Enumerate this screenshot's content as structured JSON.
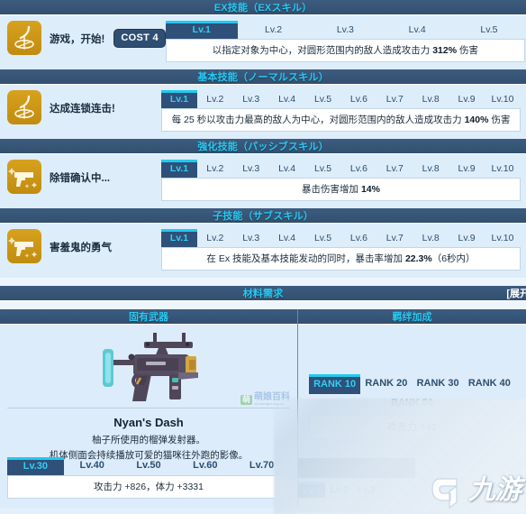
{
  "sections": {
    "ex": {
      "title": "EX技能（EXスキル）"
    },
    "normal": {
      "title": "基本技能（ノーマルスキル）"
    },
    "passive": {
      "title": "強化技能（パッシブスキル）"
    },
    "sub": {
      "title": "子技能（サブスキル）"
    },
    "material": {
      "title": "材料需求",
      "expand_label": "[展开"
    }
  },
  "skills": {
    "ex": {
      "icon_name": "ex-skill-icon",
      "name": "游戏，开始!",
      "cost": "COST 4",
      "levels": [
        "Lv.1",
        "Lv.2",
        "Lv.3",
        "Lv.4",
        "Lv.5"
      ],
      "active_level": 0,
      "desc_pre": "以指定对象为中心，对圆形范围内的敌人造成攻击力 ",
      "desc_value": "312%",
      "desc_post": " 伤害"
    },
    "normal": {
      "icon_name": "normal-skill-icon",
      "name": "达成连锁连击!",
      "levels": [
        "Lv.1",
        "Lv.2",
        "Lv.3",
        "Lv.4",
        "Lv.5",
        "Lv.6",
        "Lv.7",
        "Lv.8",
        "Lv.9",
        "Lv.10"
      ],
      "active_level": 0,
      "desc_pre": "每 25 秒以攻击力最高的敌人为中心，对圆形范围内的敌人造成攻击力 ",
      "desc_value": "140%",
      "desc_post": " 伤害"
    },
    "passive": {
      "icon_name": "passive-skill-icon",
      "name": "除错确认中...",
      "levels": [
        "Lv.1",
        "Lv.2",
        "Lv.3",
        "Lv.4",
        "Lv.5",
        "Lv.6",
        "Lv.7",
        "Lv.8",
        "Lv.9",
        "Lv.10"
      ],
      "active_level": 0,
      "desc_pre": "暴击伤害增加 ",
      "desc_value": "14%",
      "desc_post": ""
    },
    "sub": {
      "icon_name": "sub-skill-icon",
      "name": "害羞鬼的勇气",
      "levels": [
        "Lv.1",
        "Lv.2",
        "Lv.3",
        "Lv.4",
        "Lv.5",
        "Lv.6",
        "Lv.7",
        "Lv.8",
        "Lv.9",
        "Lv.10"
      ],
      "active_level": 0,
      "desc_pre": "在 Ex 技能及基本技能发动的同时，暴击率增加 ",
      "desc_value": "22.3%",
      "desc_post": "（6秒内）"
    }
  },
  "weapon": {
    "panel_title": "固有武器",
    "name": "Nyan's Dash",
    "desc_line1": "柚子所使用的榴弹发射器。",
    "desc_line2": "机体侧面会持续播放可爱的猫咪往外跑的影像。",
    "levels": [
      "Lv.30",
      "Lv.40",
      "Lv.50",
      "Lv.60",
      "Lv.70"
    ],
    "active_level": 0,
    "stat_text": "攻击力 +826，体力 +3331",
    "watermark": {
      "badge": "萌",
      "text": "萌娘百科",
      "sub": "zh.moegirl.org.cn"
    }
  },
  "bond": {
    "panel_title": "羁绊加成",
    "ranks": [
      "RANK 10",
      "RANK 20",
      "RANK 30",
      "RANK 40",
      "RANK 50"
    ],
    "active_rank": 0,
    "stat_text": "攻击力 +41"
  },
  "bottom_cut": {
    "levels": [
      "Lv.1",
      "Lv.2",
      "Lv.3"
    ],
    "active_level": 0
  },
  "overlay": {
    "logo_text": "九游"
  },
  "colors": {
    "accent_cyan": "#29c8f2",
    "bar_dark": "#32506f",
    "panel_bg": "#ddecfa",
    "icon_gold": "#d8a11e"
  }
}
